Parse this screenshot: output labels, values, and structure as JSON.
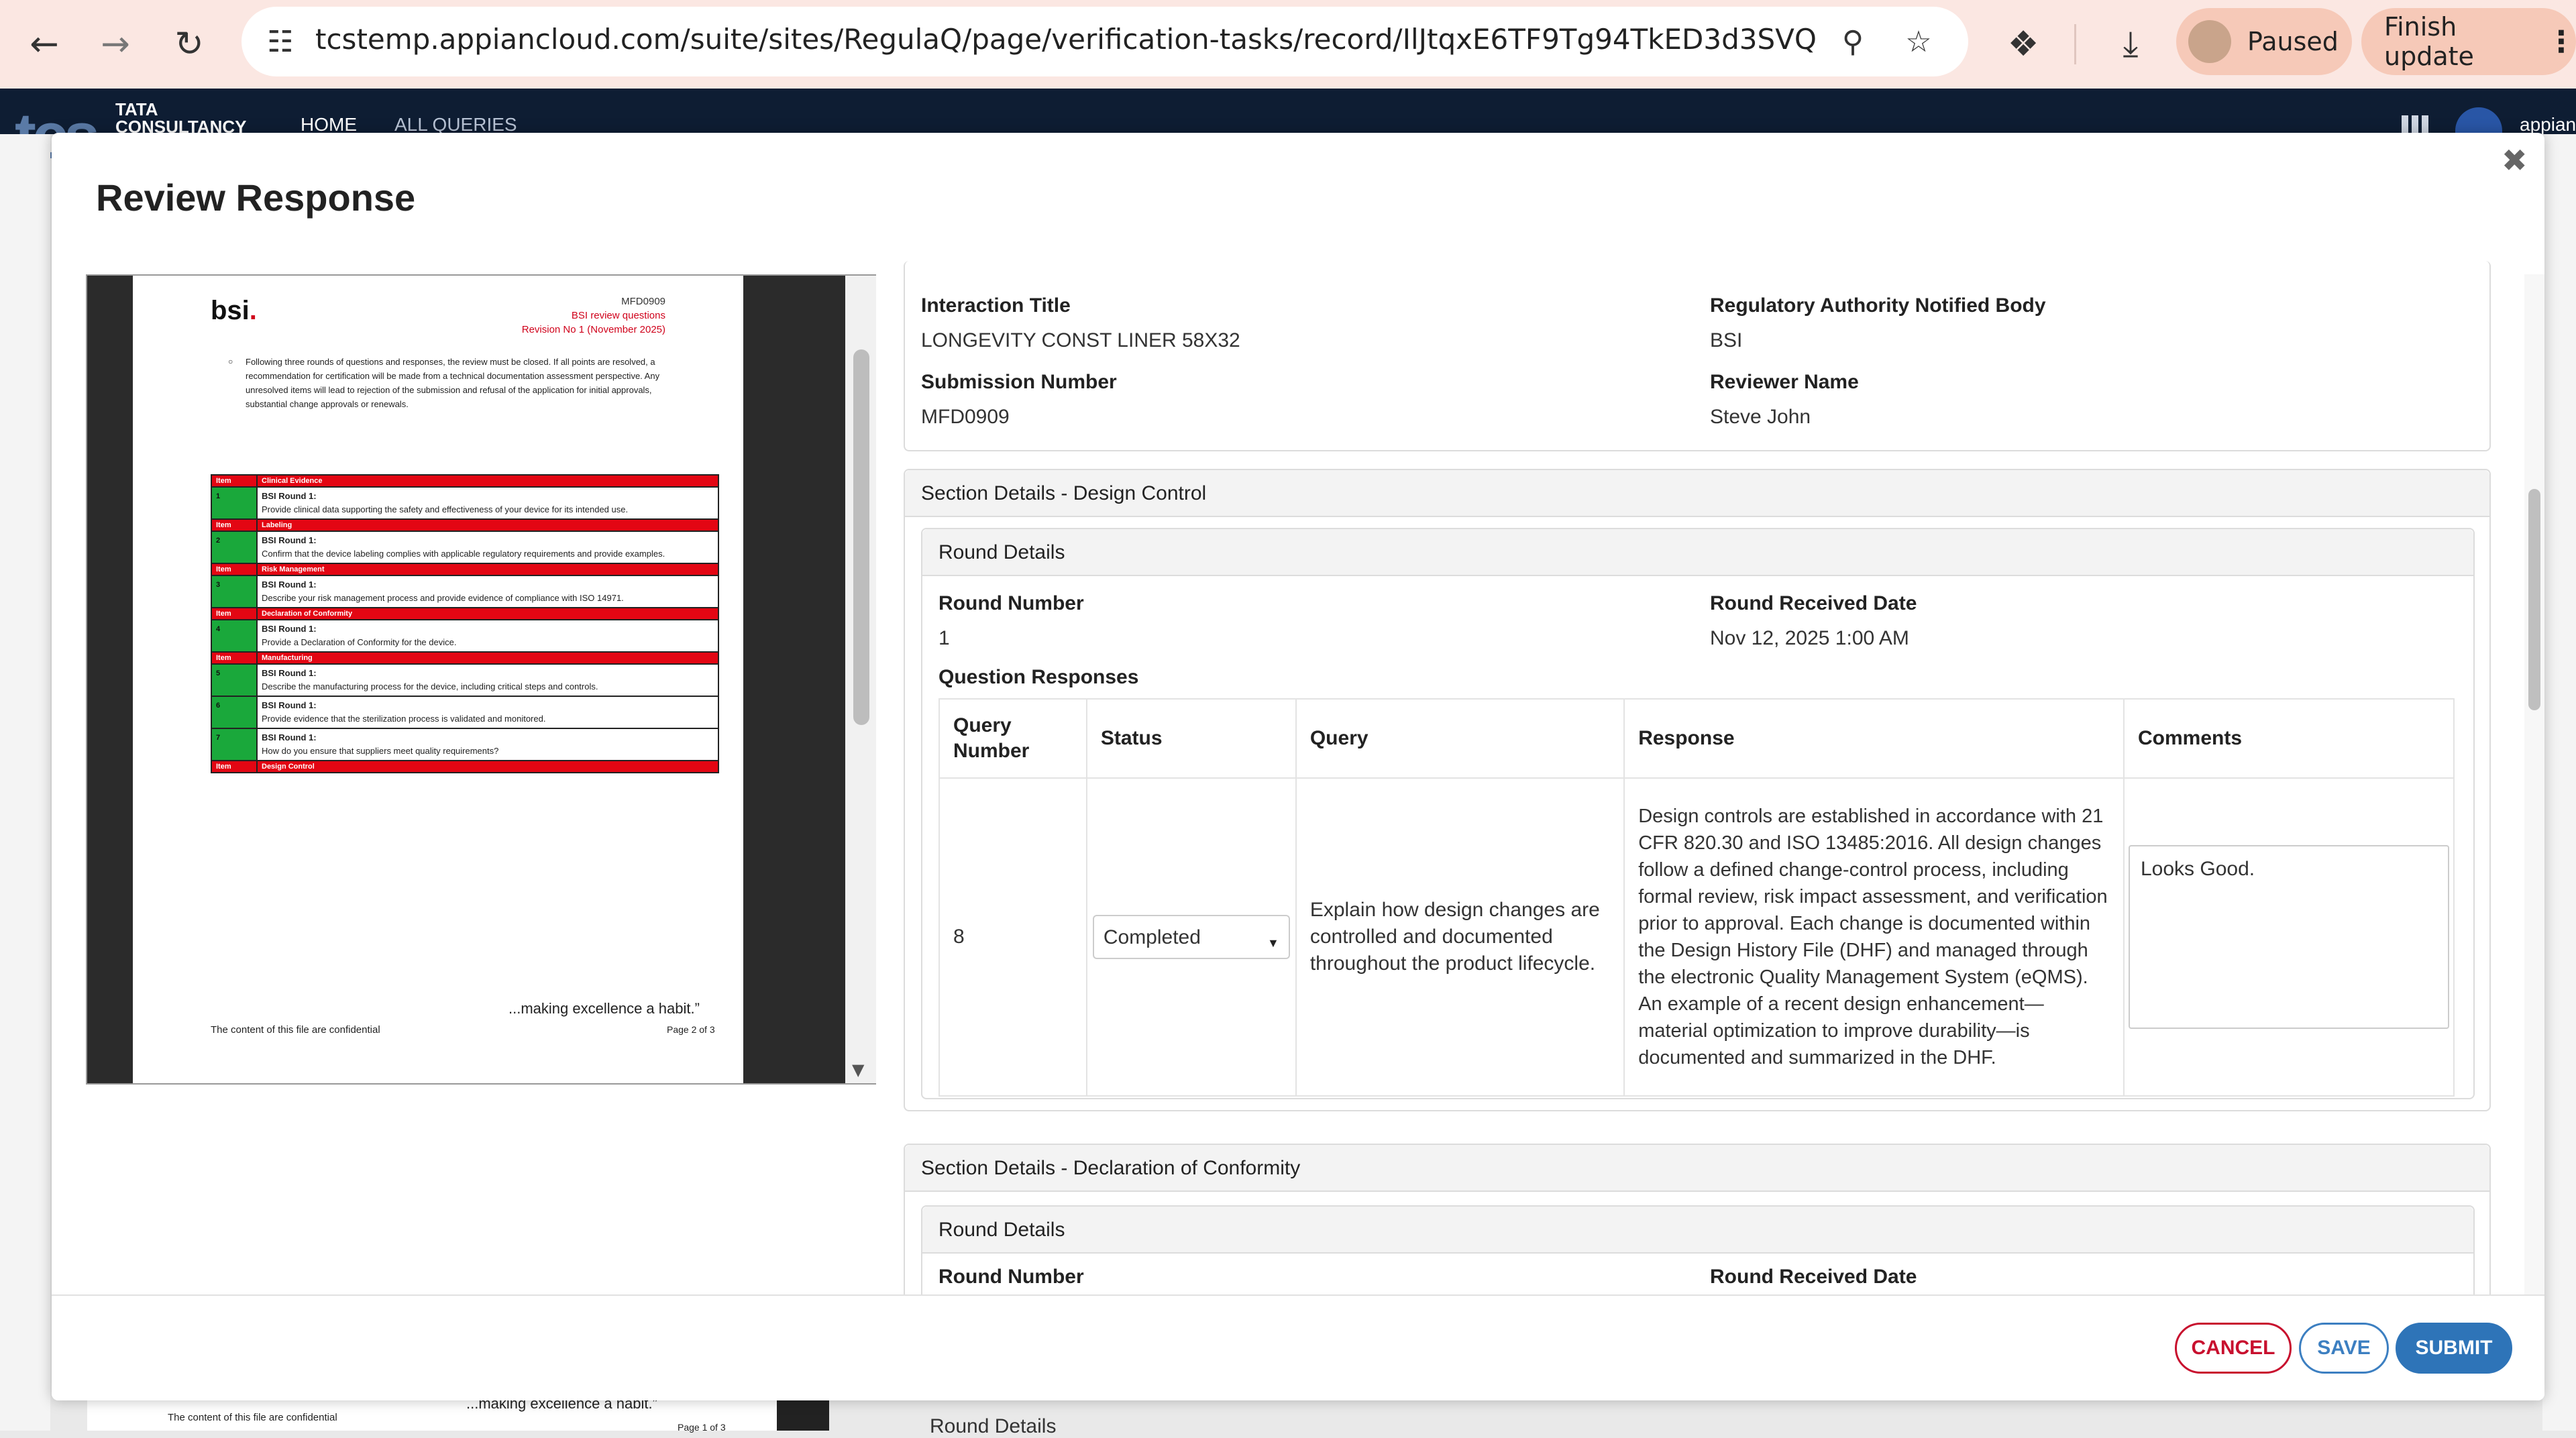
{
  "browser": {
    "url": "tcstemp.appiancloud.com/suite/sites/RegulaQ/page/verification-tasks/record/IlJtqxE6TF9Tg94TkED3d3SVQGcArswEM...",
    "paused_label": "Paused",
    "finish_label": "Finish update",
    "icons": {
      "back": "back-arrow-icon",
      "forward": "forward-arrow-icon",
      "reload": "reload-icon",
      "site": "site-settings-icon",
      "zoom": "zoom-icon",
      "star": "bookmark-star-icon",
      "ext": "extensions-icon",
      "download": "download-icon",
      "menu": "kebab-menu-icon"
    }
  },
  "app_header": {
    "logo_line1": "TATA",
    "logo_line2": "CONSULTANCY",
    "nav": [
      "HOME",
      "ALL QUERIES"
    ],
    "user_label": "appian"
  },
  "modal": {
    "title": "Review Response",
    "close_icon": "close-icon"
  },
  "document": {
    "logo": "bsi",
    "ref_code": "MFD0909",
    "ref_title": "BSI review questions",
    "ref_revision": "Revision No 1 (November 2025)",
    "bullet": "Following three rounds of questions and responses, the review must be closed. If all points are resolved, a recommendation for certification will be made from a technical documentation assessment perspective. Any unresolved items will lead to rejection of the submission and refusal of the application for initial approvals, substantial change approvals or renewals.",
    "rows": [
      {
        "head": "Clinical Evidence",
        "item": "1",
        "round": "BSI Round 1:",
        "text": "Provide clinical data supporting the safety and effectiveness of your device for its intended use."
      },
      {
        "head": "Labeling",
        "item": "2",
        "round": "BSI Round 1:",
        "text": "Confirm that the device labeling complies with applicable regulatory requirements and provide examples."
      },
      {
        "head": "Risk Management",
        "item": "3",
        "round": "BSI Round 1:",
        "text": "Describe your risk management process and provide evidence of compliance with ISO 14971."
      },
      {
        "head": "Declaration of Conformity",
        "item": "4",
        "round": "BSI Round 1:",
        "text": "Provide a Declaration of Conformity for the device."
      },
      {
        "head": "Manufacturing",
        "item": "5",
        "round": "BSI Round 1:",
        "text": "Describe the manufacturing process for the device, including critical steps and controls."
      },
      {
        "head": "",
        "item": "6",
        "round": "BSI Round 1:",
        "text": "Provide evidence that the sterilization process is validated and monitored."
      },
      {
        "head": "",
        "item": "7",
        "round": "BSI Round 1:",
        "text": "How do you ensure that suppliers meet quality requirements?"
      }
    ],
    "item_label": "Item",
    "last_head": "Design Control",
    "tagline": "...making excellence a habit.”",
    "confidential": "The content of this file are confidential",
    "page": "Page 2 of 3",
    "behind_page": "Page 1 of 3"
  },
  "submission": {
    "interaction_title_label": "Interaction Title",
    "interaction_title": "LONGEVITY CONST LINER 58X32",
    "authority_label": "Regulatory Authority Notified Body",
    "authority": "BSI",
    "submission_number_label": "Submission Number",
    "submission_number": "MFD0909",
    "reviewer_label": "Reviewer Name",
    "reviewer": "Steve John"
  },
  "section1": {
    "title": "Section Details - Design Control",
    "round_title": "Round Details",
    "round_number_label": "Round Number",
    "round_number": "1",
    "round_date_label": "Round Received Date",
    "round_date": "Nov 12, 2025 1:00 AM",
    "qr_label": "Question Responses",
    "columns": [
      "Query Number",
      "Status",
      "Query",
      "Response",
      "Comments"
    ],
    "row": {
      "number": "8",
      "status": "Completed",
      "query": "Explain how design changes are controlled and documented throughout the product lifecycle.",
      "response": "Design controls are established in accordance with 21 CFR 820.30 and ISO 13485:2016. All design changes follow a defined change-control process, including formal review, risk impact assessment, and verification prior to approval. Each change is documented within the Design History File (DHF) and managed through the electronic Quality Management System (eQMS). An example of a recent design enhancement—material optimization to improve durability—is documented and summarized in the DHF.",
      "comment": "Looks Good."
    }
  },
  "section2": {
    "title": "Section Details - Declaration of Conformity",
    "round_title": "Round Details",
    "round_number_label": "Round Number",
    "round_date_label": "Round Received Date"
  },
  "footer": {
    "cancel": "CANCEL",
    "save": "SAVE",
    "submit": "SUBMIT"
  },
  "behind": {
    "round_title": "Round Details"
  }
}
